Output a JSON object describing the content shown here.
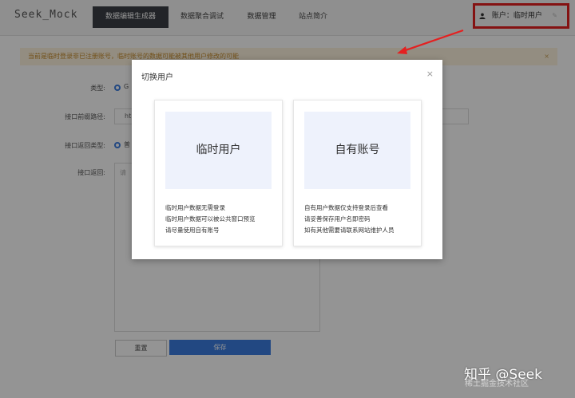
{
  "header": {
    "logo": "Seek_Mock",
    "tabs": [
      {
        "label": "数据编辑生成器",
        "active": true
      },
      {
        "label": "数据聚合调试",
        "active": false
      },
      {
        "label": "数据管理",
        "active": false
      },
      {
        "label": "站点简介",
        "active": false
      }
    ],
    "account_label": "账户：临时用户"
  },
  "notice": {
    "text": "当前是临时登录非已注册账号，临时账号的数据可能被其他用户修改的可能",
    "close": "×"
  },
  "form": {
    "type_label": "类型:",
    "type_value": "G",
    "path_label": "接口前缀路径:",
    "path_value": "ht",
    "return_type_label": "接口返回类型:",
    "return_type_value": "普",
    "return_label": "接口返回:",
    "return_placeholder": "请",
    "reset_label": "重置",
    "save_label": "保存"
  },
  "modal": {
    "title": "切换用户",
    "close": "×",
    "cards": [
      {
        "title": "临时用户",
        "lines": [
          "临时用户数据无需登录",
          "临时用户数据可以被公共窗口预览",
          "请尽量使用自有账号"
        ]
      },
      {
        "title": "自有账号",
        "lines": [
          "自有用户数据仅支持登录后查看",
          "请妥善保存用户名即密码",
          "如有其他需要请联系网站维护人员"
        ]
      }
    ]
  },
  "watermark": {
    "main": "知乎 @Seek",
    "sub": "稀土掘金技术社区"
  },
  "colors": {
    "accent": "#3b7de0",
    "highlight_red": "#e42020",
    "nav_active": "#3b3f45"
  }
}
